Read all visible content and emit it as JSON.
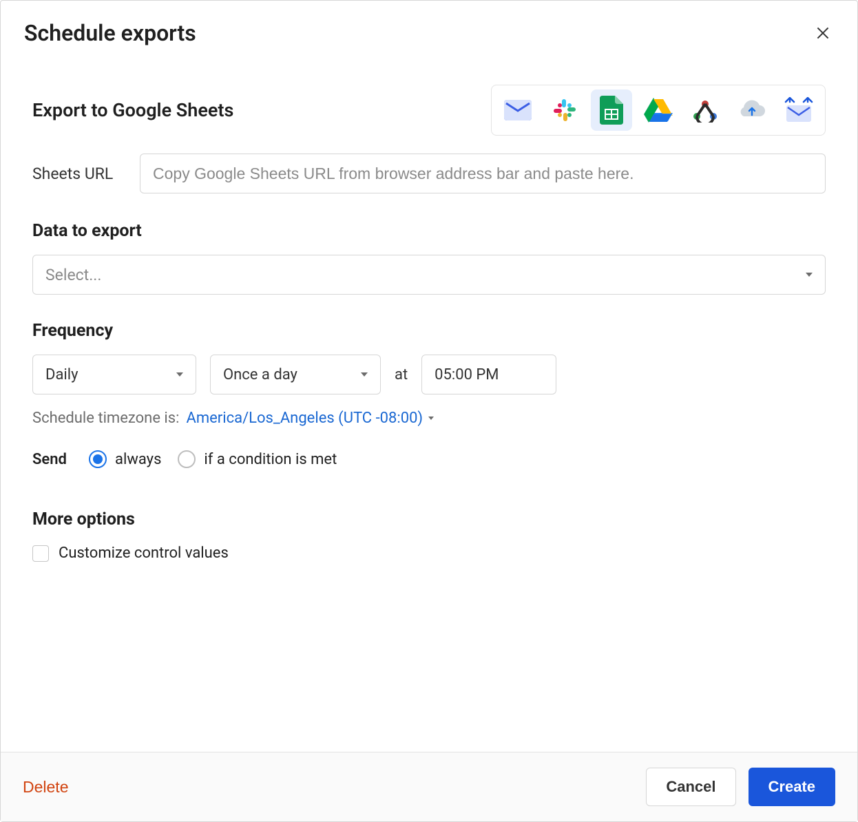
{
  "header": {
    "title": "Schedule exports"
  },
  "export": {
    "title": "Export to Google Sheets",
    "sheets_url_label": "Sheets URL",
    "sheets_url_placeholder": "Copy Google Sheets URL from browser address bar and paste here.",
    "destinations": {
      "email": "email-icon",
      "slack": "slack-icon",
      "google_sheets": "google-sheets-icon",
      "google_drive": "google-drive-icon",
      "webhook": "webhook-icon",
      "cloud_upload": "cloud-upload-icon",
      "mail_transfer": "mail-transfer-icon"
    }
  },
  "data_section": {
    "heading": "Data to export",
    "select_placeholder": "Select..."
  },
  "frequency": {
    "heading": "Frequency",
    "interval": "Daily",
    "repeat": "Once a day",
    "at_label": "at",
    "time": "05:00 PM",
    "tz_label": "Schedule timezone is:",
    "tz_value": "America/Los_Angeles (UTC -08:00)"
  },
  "send": {
    "label": "Send",
    "option_always": "always",
    "option_condition": "if a condition is met"
  },
  "more": {
    "heading": "More options",
    "customize_label": "Customize control values"
  },
  "footer": {
    "delete": "Delete",
    "cancel": "Cancel",
    "create": "Create"
  }
}
